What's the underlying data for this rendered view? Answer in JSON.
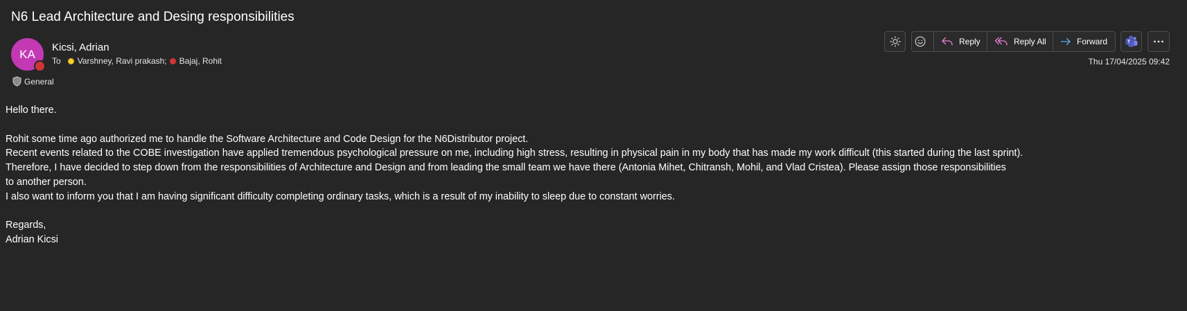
{
  "email": {
    "subject": "N6 Lead Architecture and Desing responsibilities",
    "sender": {
      "initials": "KA",
      "name": "Kicsi, Adrian",
      "avatar_color": "#c239b3",
      "presence": "busy"
    },
    "to_label": "To",
    "recipients": [
      {
        "name": "Varshney, Ravi prakash;",
        "presence": "away"
      },
      {
        "name": "Bajaj, Rohit",
        "presence": "busy"
      }
    ],
    "category": "General",
    "timestamp": "Thu 17/04/2025 09:42"
  },
  "toolbar": {
    "theme_icon": "sun-icon",
    "emoji_icon": "emoji-smile-icon",
    "reply_label": "Reply",
    "reply_all_label": "Reply All",
    "forward_label": "Forward",
    "teams_icon": "teams-icon",
    "more_icon": "more-horizontal-icon"
  },
  "body": {
    "lines": [
      "Hello there.",
      "",
      "Rohit some time ago authorized me to handle the Software Architecture and Code Design for the N6Distributor project.",
      "Recent events related to the COBE investigation have applied tremendous psychological pressure on me, including high stress, resulting in physical pain in my body that has made my work difficult (this started during the last sprint).",
      "Therefore, I have decided to step down from the responsibilities of Architecture and Design and from leading the small team we have there (Antonia Mihet, Chitransh, Mohil, and Vlad Cristea). Please assign those responsibilities",
      "to another person.",
      "I also want to inform you that I am having significant difficulty completing ordinary tasks, which is a result of my inability to sleep due to constant worries.",
      "",
      "Regards,",
      "Adrian Kicsi"
    ]
  },
  "colors": {
    "background": "#262626",
    "button_border": "#4d4d4d",
    "reply_accent": "#e87fd6",
    "forward_accent": "#5aa9e6",
    "teams_accent": "#5b5fc7"
  }
}
